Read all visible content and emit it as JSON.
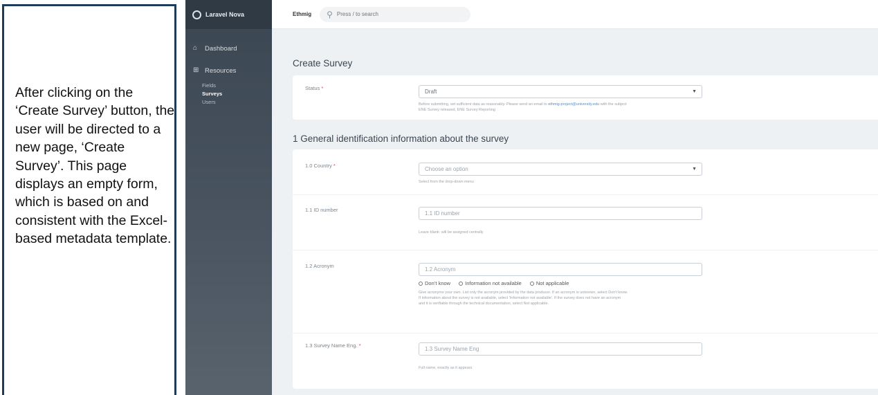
{
  "note": "After clicking on the ‘Create Survey’ button, the user will be directed to a new page, ‘Create Survey’. This page displays an empty form, which is based on and consistent with the Excel-based metadata template.",
  "sidebar": {
    "brand": "Laravel Nova",
    "items": [
      {
        "label": "Dashboard",
        "icon": "home-icon"
      },
      {
        "label": "Resources",
        "icon": "grid-icon"
      }
    ],
    "sub_items": [
      {
        "label": "Fields",
        "active": false
      },
      {
        "label": "Surveys",
        "active": true
      },
      {
        "label": "Users",
        "active": false
      }
    ]
  },
  "topbar": {
    "brand": "Ethmig",
    "search_placeholder": "Press / to search"
  },
  "page": {
    "title": "Create Survey",
    "status_label": "Status",
    "status_value": "Draft",
    "status_help_a": "Before submitting, set sufficient data as reasonably. Please send an email to ",
    "status_help_link": "ethmig-project@university.edu",
    "status_help_b": " with the subject",
    "status_help_c": "ENE Survey released, ENE Survey Reporting",
    "section1_title": "1 General identification information about the survey",
    "fields": {
      "country_label": "1.0 Country",
      "country_value": "Choose an option",
      "country_help": "Select from the drop-down menu",
      "id_label": "1.1 ID number",
      "id_placeholder": "1.1 ID number",
      "id_help": "Leave blank: will be assigned centrally",
      "acronym_label": "1.2 Acronym",
      "acronym_placeholder": "1.2 Acronym",
      "acronym_options": [
        "Don’t know",
        "Information not available",
        "Not applicable"
      ],
      "acronym_help_1": "Give acronyms your own. List only the acronym provided by the data producer. If an acronym is unknown, select Don't know.",
      "acronym_help_2": "If information about the survey is not available, select 'Information not available'. If the survey does not have an acronym",
      "acronym_help_3": "and it is verifiable through the technical documentation, select Not applicable.",
      "name_label": "1.3 Survey Name Eng.",
      "name_placeholder": "1.3 Survey Name Eng",
      "name_help": "Full name, exactly as it appears"
    },
    "required_marker": "*"
  },
  "colors": {
    "sidebar": "#3a4651",
    "note_border": "#1f3b5a",
    "required": "#e74444",
    "link": "#4a8fd6"
  }
}
